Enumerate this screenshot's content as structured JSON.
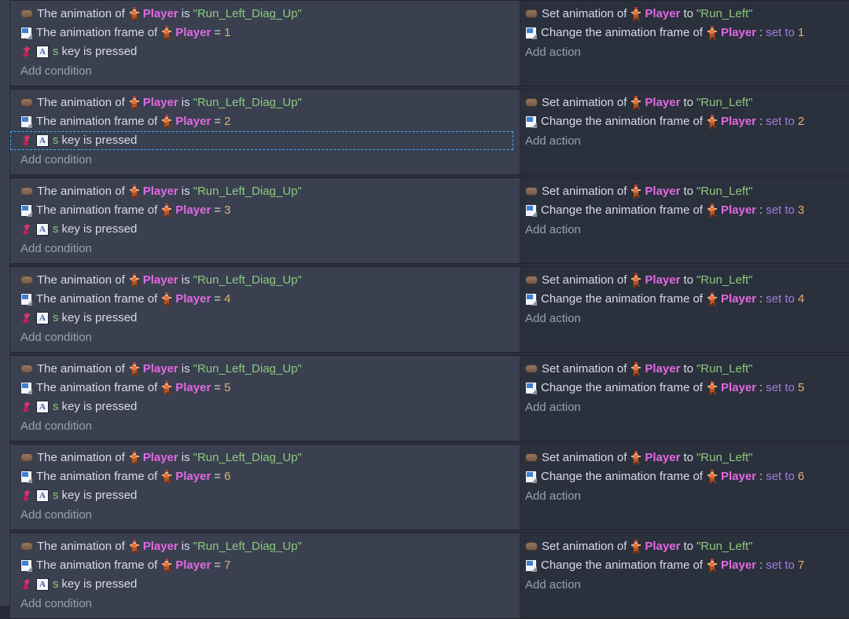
{
  "app": {
    "name": "gdevelop-event-sheet",
    "theme_colors": {
      "conditions_background": "#3a4050",
      "actions_background": "#2b303d",
      "object_text": "#e268e2",
      "string_text": "#8cc97f",
      "number_text": "#e0b070",
      "keyword_text": "#a07ddc",
      "plain_text": "#d8dce6",
      "muted_text": "#9aa0ad",
      "selection_outline": "#3fa9f5"
    }
  },
  "labels": {
    "add_condition": "Add condition",
    "add_action": "Add action"
  },
  "icons": {
    "animation": "animation-icon",
    "animation_frame": "animation-frame-icon",
    "keyboard_event": "keyboard-event-icon",
    "keycap": "A",
    "player_sprite": "player-sprite-icon"
  },
  "events": [
    {
      "index": 1,
      "conditions": [
        {
          "icon": "animation-icon",
          "selected": false,
          "tokens": [
            {
              "t": "plain",
              "v": "The animation of"
            },
            {
              "t": "object",
              "v": "Player",
              "sprite": true
            },
            {
              "t": "plain",
              "v": "is"
            },
            {
              "t": "string",
              "v": "\"Run_Left_Diag_Up\""
            }
          ]
        },
        {
          "icon": "animation-frame-icon",
          "selected": false,
          "tokens": [
            {
              "t": "plain",
              "v": "The animation frame of"
            },
            {
              "t": "object",
              "v": "Player",
              "sprite": true
            },
            {
              "t": "plain",
              "v": "="
            },
            {
              "t": "number",
              "v": "1"
            }
          ]
        },
        {
          "icon": "keyboard-event-icon",
          "keycap": "A",
          "selected": false,
          "tokens": [
            {
              "t": "key",
              "v": "s"
            },
            {
              "t": "plain",
              "v": "key is pressed"
            }
          ]
        }
      ],
      "actions": [
        {
          "icon": "animation-icon",
          "tokens": [
            {
              "t": "plain",
              "v": "Set animation of"
            },
            {
              "t": "object",
              "v": "Player",
              "sprite": true
            },
            {
              "t": "plain",
              "v": "to"
            },
            {
              "t": "string",
              "v": "\"Run_Left\""
            }
          ]
        },
        {
          "icon": "animation-frame-icon",
          "tokens": [
            {
              "t": "plain",
              "v": "Change the animation frame of"
            },
            {
              "t": "object",
              "v": "Player",
              "sprite": true
            },
            {
              "t": "plain",
              "v": ":"
            },
            {
              "t": "keyword",
              "v": "set to"
            },
            {
              "t": "number",
              "v": "1"
            }
          ]
        }
      ]
    },
    {
      "index": 2,
      "conditions": [
        {
          "icon": "animation-icon",
          "selected": false,
          "tokens": [
            {
              "t": "plain",
              "v": "The animation of"
            },
            {
              "t": "object",
              "v": "Player",
              "sprite": true
            },
            {
              "t": "plain",
              "v": "is"
            },
            {
              "t": "string",
              "v": "\"Run_Left_Diag_Up\""
            }
          ]
        },
        {
          "icon": "animation-frame-icon",
          "selected": false,
          "tokens": [
            {
              "t": "plain",
              "v": "The animation frame of"
            },
            {
              "t": "object",
              "v": "Player",
              "sprite": true
            },
            {
              "t": "plain",
              "v": "="
            },
            {
              "t": "number",
              "v": "2"
            }
          ]
        },
        {
          "icon": "keyboard-event-icon",
          "keycap": "A",
          "selected": true,
          "tokens": [
            {
              "t": "key",
              "v": "s"
            },
            {
              "t": "plain",
              "v": "key is pressed"
            }
          ]
        }
      ],
      "actions": [
        {
          "icon": "animation-icon",
          "tokens": [
            {
              "t": "plain",
              "v": "Set animation of"
            },
            {
              "t": "object",
              "v": "Player",
              "sprite": true
            },
            {
              "t": "plain",
              "v": "to"
            },
            {
              "t": "string",
              "v": "\"Run_Left\""
            }
          ]
        },
        {
          "icon": "animation-frame-icon",
          "tokens": [
            {
              "t": "plain",
              "v": "Change the animation frame of"
            },
            {
              "t": "object",
              "v": "Player",
              "sprite": true
            },
            {
              "t": "plain",
              "v": ":"
            },
            {
              "t": "keyword",
              "v": "set to"
            },
            {
              "t": "number",
              "v": "2"
            }
          ]
        }
      ]
    },
    {
      "index": 3,
      "conditions": [
        {
          "icon": "animation-icon",
          "selected": false,
          "tokens": [
            {
              "t": "plain",
              "v": "The animation of"
            },
            {
              "t": "object",
              "v": "Player",
              "sprite": true
            },
            {
              "t": "plain",
              "v": "is"
            },
            {
              "t": "string",
              "v": "\"Run_Left_Diag_Up\""
            }
          ]
        },
        {
          "icon": "animation-frame-icon",
          "selected": false,
          "tokens": [
            {
              "t": "plain",
              "v": "The animation frame of"
            },
            {
              "t": "object",
              "v": "Player",
              "sprite": true
            },
            {
              "t": "plain",
              "v": "="
            },
            {
              "t": "number",
              "v": "3"
            }
          ]
        },
        {
          "icon": "keyboard-event-icon",
          "keycap": "A",
          "selected": false,
          "tokens": [
            {
              "t": "key",
              "v": "s"
            },
            {
              "t": "plain",
              "v": "key is pressed"
            }
          ]
        }
      ],
      "actions": [
        {
          "icon": "animation-icon",
          "tokens": [
            {
              "t": "plain",
              "v": "Set animation of"
            },
            {
              "t": "object",
              "v": "Player",
              "sprite": true
            },
            {
              "t": "plain",
              "v": "to"
            },
            {
              "t": "string",
              "v": "\"Run_Left\""
            }
          ]
        },
        {
          "icon": "animation-frame-icon",
          "tokens": [
            {
              "t": "plain",
              "v": "Change the animation frame of"
            },
            {
              "t": "object",
              "v": "Player",
              "sprite": true
            },
            {
              "t": "plain",
              "v": ":"
            },
            {
              "t": "keyword",
              "v": "set to"
            },
            {
              "t": "number",
              "v": "3"
            }
          ]
        }
      ]
    },
    {
      "index": 4,
      "conditions": [
        {
          "icon": "animation-icon",
          "selected": false,
          "tokens": [
            {
              "t": "plain",
              "v": "The animation of"
            },
            {
              "t": "object",
              "v": "Player",
              "sprite": true
            },
            {
              "t": "plain",
              "v": "is"
            },
            {
              "t": "string",
              "v": "\"Run_Left_Diag_Up\""
            }
          ]
        },
        {
          "icon": "animation-frame-icon",
          "selected": false,
          "tokens": [
            {
              "t": "plain",
              "v": "The animation frame of"
            },
            {
              "t": "object",
              "v": "Player",
              "sprite": true
            },
            {
              "t": "plain",
              "v": "="
            },
            {
              "t": "number",
              "v": "4"
            }
          ]
        },
        {
          "icon": "keyboard-event-icon",
          "keycap": "A",
          "selected": false,
          "tokens": [
            {
              "t": "key",
              "v": "s"
            },
            {
              "t": "plain",
              "v": "key is pressed"
            }
          ]
        }
      ],
      "actions": [
        {
          "icon": "animation-icon",
          "tokens": [
            {
              "t": "plain",
              "v": "Set animation of"
            },
            {
              "t": "object",
              "v": "Player",
              "sprite": true
            },
            {
              "t": "plain",
              "v": "to"
            },
            {
              "t": "string",
              "v": "\"Run_Left\""
            }
          ]
        },
        {
          "icon": "animation-frame-icon",
          "tokens": [
            {
              "t": "plain",
              "v": "Change the animation frame of"
            },
            {
              "t": "object",
              "v": "Player",
              "sprite": true
            },
            {
              "t": "plain",
              "v": ":"
            },
            {
              "t": "keyword",
              "v": "set to"
            },
            {
              "t": "number",
              "v": "4"
            }
          ]
        }
      ]
    },
    {
      "index": 5,
      "conditions": [
        {
          "icon": "animation-icon",
          "selected": false,
          "tokens": [
            {
              "t": "plain",
              "v": "The animation of"
            },
            {
              "t": "object",
              "v": "Player",
              "sprite": true
            },
            {
              "t": "plain",
              "v": "is"
            },
            {
              "t": "string",
              "v": "\"Run_Left_Diag_Up\""
            }
          ]
        },
        {
          "icon": "animation-frame-icon",
          "selected": false,
          "tokens": [
            {
              "t": "plain",
              "v": "The animation frame of"
            },
            {
              "t": "object",
              "v": "Player",
              "sprite": true
            },
            {
              "t": "plain",
              "v": "="
            },
            {
              "t": "number",
              "v": "5"
            }
          ]
        },
        {
          "icon": "keyboard-event-icon",
          "keycap": "A",
          "selected": false,
          "tokens": [
            {
              "t": "key",
              "v": "s"
            },
            {
              "t": "plain",
              "v": "key is pressed"
            }
          ]
        }
      ],
      "actions": [
        {
          "icon": "animation-icon",
          "tokens": [
            {
              "t": "plain",
              "v": "Set animation of"
            },
            {
              "t": "object",
              "v": "Player",
              "sprite": true
            },
            {
              "t": "plain",
              "v": "to"
            },
            {
              "t": "string",
              "v": "\"Run_Left\""
            }
          ]
        },
        {
          "icon": "animation-frame-icon",
          "tokens": [
            {
              "t": "plain",
              "v": "Change the animation frame of"
            },
            {
              "t": "object",
              "v": "Player",
              "sprite": true
            },
            {
              "t": "plain",
              "v": ":"
            },
            {
              "t": "keyword",
              "v": "set to"
            },
            {
              "t": "number",
              "v": "5"
            }
          ]
        }
      ]
    },
    {
      "index": 6,
      "conditions": [
        {
          "icon": "animation-icon",
          "selected": false,
          "tokens": [
            {
              "t": "plain",
              "v": "The animation of"
            },
            {
              "t": "object",
              "v": "Player",
              "sprite": true
            },
            {
              "t": "plain",
              "v": "is"
            },
            {
              "t": "string",
              "v": "\"Run_Left_Diag_Up\""
            }
          ]
        },
        {
          "icon": "animation-frame-icon",
          "selected": false,
          "tokens": [
            {
              "t": "plain",
              "v": "The animation frame of"
            },
            {
              "t": "object",
              "v": "Player",
              "sprite": true
            },
            {
              "t": "plain",
              "v": "="
            },
            {
              "t": "number",
              "v": "6"
            }
          ]
        },
        {
          "icon": "keyboard-event-icon",
          "keycap": "A",
          "selected": false,
          "tokens": [
            {
              "t": "key",
              "v": "s"
            },
            {
              "t": "plain",
              "v": "key is pressed"
            }
          ]
        }
      ],
      "actions": [
        {
          "icon": "animation-icon",
          "tokens": [
            {
              "t": "plain",
              "v": "Set animation of"
            },
            {
              "t": "object",
              "v": "Player",
              "sprite": true
            },
            {
              "t": "plain",
              "v": "to"
            },
            {
              "t": "string",
              "v": "\"Run_Left\""
            }
          ]
        },
        {
          "icon": "animation-frame-icon",
          "tokens": [
            {
              "t": "plain",
              "v": "Change the animation frame of"
            },
            {
              "t": "object",
              "v": "Player",
              "sprite": true
            },
            {
              "t": "plain",
              "v": ":"
            },
            {
              "t": "keyword",
              "v": "set to"
            },
            {
              "t": "number",
              "v": "6"
            }
          ]
        }
      ]
    },
    {
      "index": 7,
      "conditions": [
        {
          "icon": "animation-icon",
          "selected": false,
          "tokens": [
            {
              "t": "plain",
              "v": "The animation of"
            },
            {
              "t": "object",
              "v": "Player",
              "sprite": true
            },
            {
              "t": "plain",
              "v": "is"
            },
            {
              "t": "string",
              "v": "\"Run_Left_Diag_Up\""
            }
          ]
        },
        {
          "icon": "animation-frame-icon",
          "selected": false,
          "tokens": [
            {
              "t": "plain",
              "v": "The animation frame of"
            },
            {
              "t": "object",
              "v": "Player",
              "sprite": true
            },
            {
              "t": "plain",
              "v": "="
            },
            {
              "t": "number",
              "v": "7"
            }
          ]
        },
        {
          "icon": "keyboard-event-icon",
          "keycap": "A",
          "selected": false,
          "tokens": [
            {
              "t": "key",
              "v": "s"
            },
            {
              "t": "plain",
              "v": "key is pressed"
            }
          ]
        }
      ],
      "actions": [
        {
          "icon": "animation-icon",
          "tokens": [
            {
              "t": "plain",
              "v": "Set animation of"
            },
            {
              "t": "object",
              "v": "Player",
              "sprite": true
            },
            {
              "t": "plain",
              "v": "to"
            },
            {
              "t": "string",
              "v": "\"Run_Left\""
            }
          ]
        },
        {
          "icon": "animation-frame-icon",
          "tokens": [
            {
              "t": "plain",
              "v": "Change the animation frame of"
            },
            {
              "t": "object",
              "v": "Player",
              "sprite": true
            },
            {
              "t": "plain",
              "v": ":"
            },
            {
              "t": "keyword",
              "v": "set to"
            },
            {
              "t": "number",
              "v": "7"
            }
          ]
        }
      ]
    }
  ]
}
